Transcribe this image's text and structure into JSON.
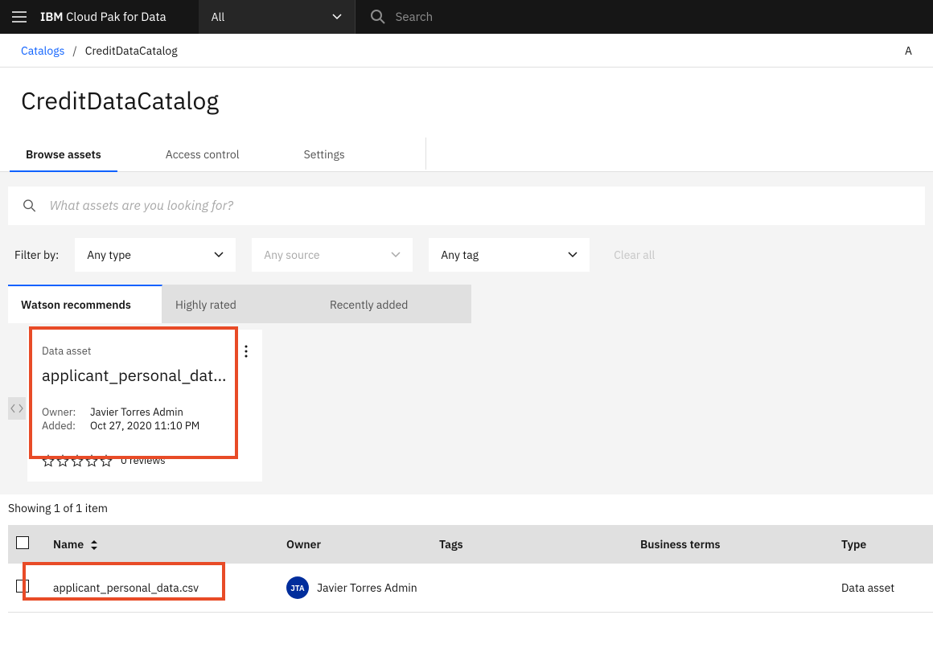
{
  "header": {
    "brand_ibm": "IBM",
    "brand_rest": " Cloud Pak for Data",
    "scope_label": "All",
    "search_placeholder": "Search"
  },
  "breadcrumb": {
    "root": "Catalogs",
    "current": "CreditDataCatalog",
    "right": "A"
  },
  "page_title": "CreditDataCatalog",
  "subtabs": {
    "browse": "Browse assets",
    "access": "Access control",
    "settings": "Settings"
  },
  "asset_search_placeholder": "What assets are you looking for?",
  "filters": {
    "label": "Filter by:",
    "type": "Any type",
    "source": "Any source",
    "tag": "Any tag",
    "clear": "Clear all"
  },
  "rec_tabs": {
    "watson": "Watson recommends",
    "highly": "Highly rated",
    "recent": "Recently added"
  },
  "card": {
    "asset_type": "Data asset",
    "title": "applicant_personal_dat...",
    "owner_k": "Owner:",
    "owner_v": "Javier Torres Admin",
    "added_k": "Added:",
    "added_v": "Oct 27, 2020 11:10 PM",
    "reviews": "0 reviews"
  },
  "showing": "Showing 1 of 1 item",
  "table": {
    "headers": {
      "name": "Name",
      "owner": "Owner",
      "tags": "Tags",
      "terms": "Business terms",
      "type": "Type"
    },
    "rows": [
      {
        "name": "applicant_personal_data.csv",
        "owner_initials": "JTA",
        "owner": "Javier Torres Admin",
        "tags": "",
        "terms": "",
        "type": "Data asset"
      }
    ]
  }
}
